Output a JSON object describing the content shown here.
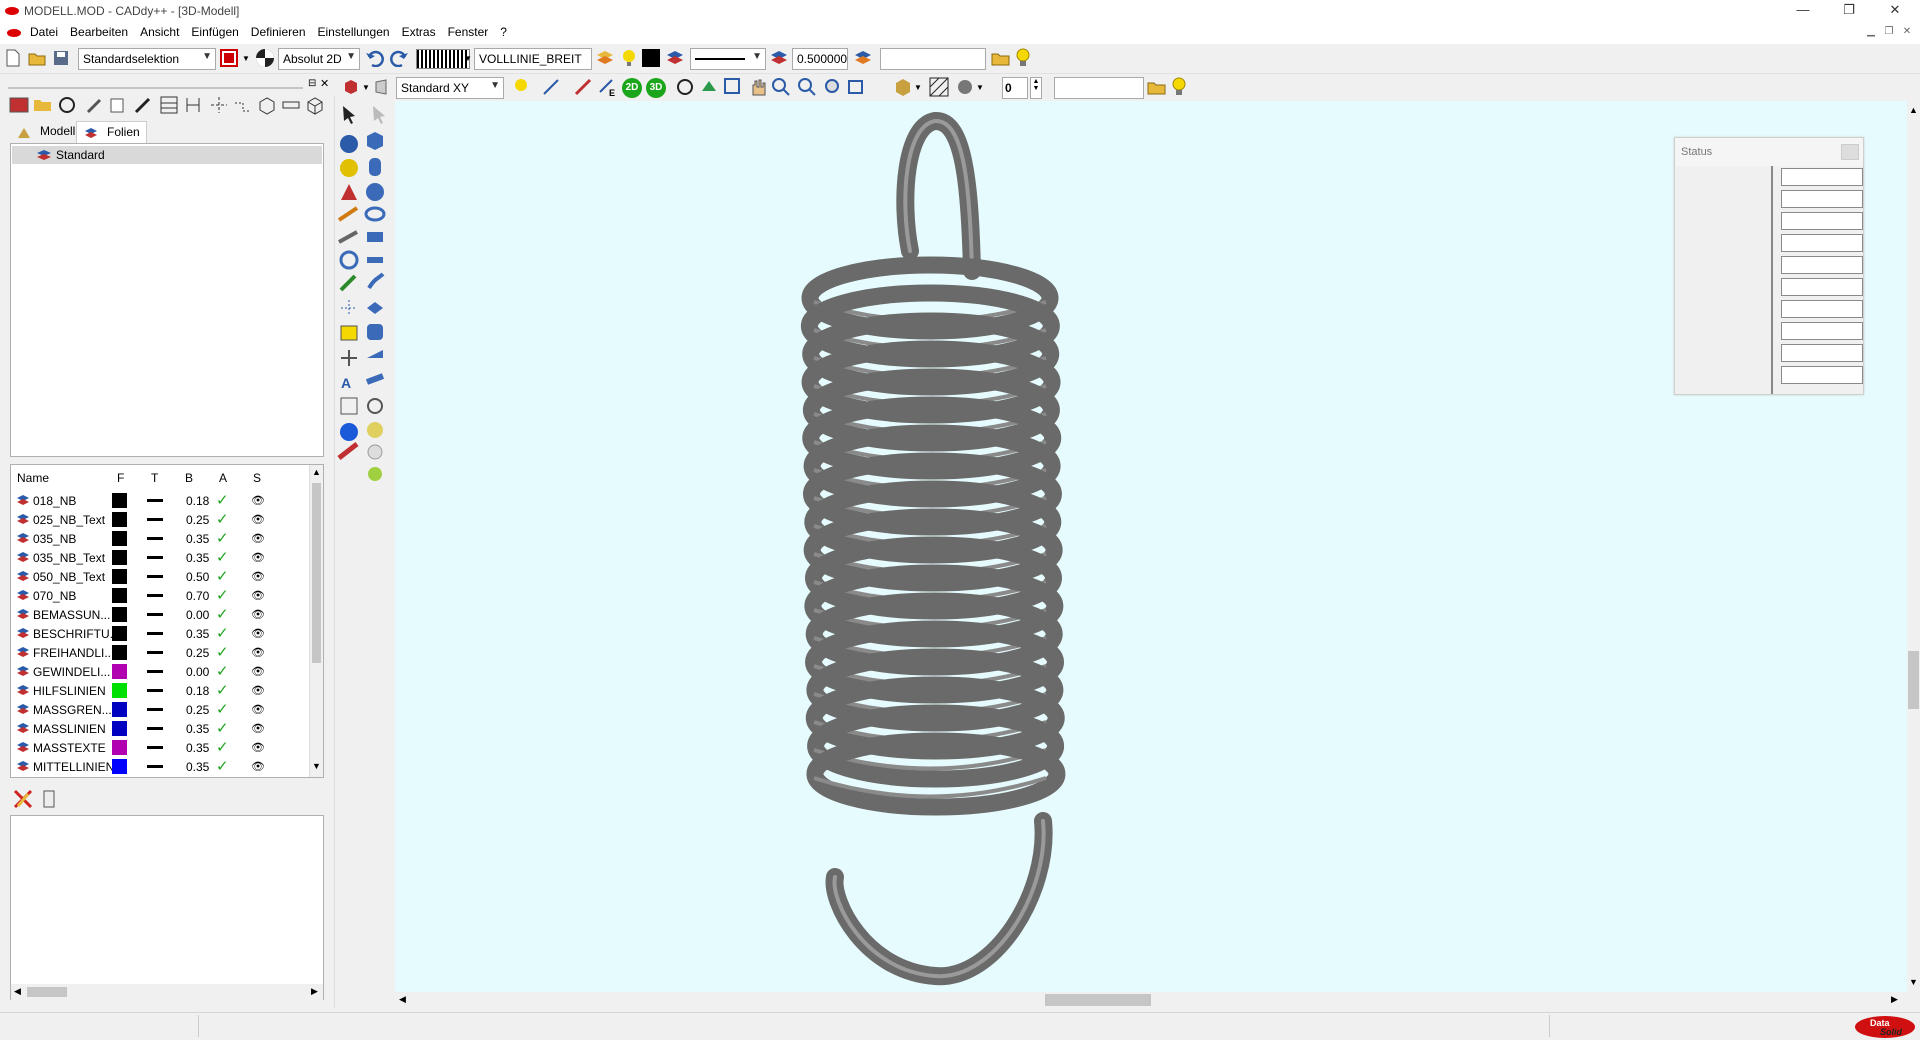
{
  "window": {
    "title": "MODELL.MOD  -  CADdy++ - [3D-Modell]",
    "min": "—",
    "max": "❐",
    "close": "✕"
  },
  "menu": [
    "Datei",
    "Bearbeiten",
    "Ansicht",
    "Einfügen",
    "Definieren",
    "Einstellungen",
    "Extras",
    "Fenster",
    "?"
  ],
  "toolbar1": {
    "selection_mode": "Standardselektion",
    "coord_mode": "Absolut 2D",
    "linetype_name": "VOLLLINIE_BREIT",
    "line_width": "0.500000",
    "text_field": ""
  },
  "toolbar2": {
    "view_plane": "Standard XY",
    "btn_2d": "2D",
    "btn_3d": "3D",
    "step_value": "0",
    "text_field": ""
  },
  "tabs": [
    {
      "label": "Modell",
      "active": false
    },
    {
      "label": "Folien",
      "active": true
    }
  ],
  "layer_tree": {
    "root": "Standard"
  },
  "layer_table": {
    "headers": {
      "name": "Name",
      "f": "F",
      "t": "T",
      "b": "B",
      "a": "A",
      "s": "S"
    },
    "rows": [
      {
        "name": "018_NB",
        "color": "#000000",
        "width": "0.18"
      },
      {
        "name": "025_NB_Text",
        "color": "#000000",
        "width": "0.25"
      },
      {
        "name": "035_NB",
        "color": "#000000",
        "width": "0.35"
      },
      {
        "name": "035_NB_Text",
        "color": "#000000",
        "width": "0.35"
      },
      {
        "name": "050_NB_Text",
        "color": "#000000",
        "width": "0.50"
      },
      {
        "name": "070_NB",
        "color": "#000000",
        "width": "0.70"
      },
      {
        "name": "BEMASSUN...",
        "color": "#000000",
        "width": "0.00"
      },
      {
        "name": "BESCHRIFTU...",
        "color": "#000000",
        "width": "0.35"
      },
      {
        "name": "FREIHANDLI...",
        "color": "#000000",
        "width": "0.25"
      },
      {
        "name": "GEWINDELI...",
        "color": "#b000b0",
        "width": "0.00"
      },
      {
        "name": "HILFSLINIEN",
        "color": "#00e000",
        "width": "0.18"
      },
      {
        "name": "MASSGREN...",
        "color": "#0000c0",
        "width": "0.25"
      },
      {
        "name": "MASSLINIEN",
        "color": "#0000c0",
        "width": "0.35"
      },
      {
        "name": "MASSTEXTE",
        "color": "#b000b0",
        "width": "0.35"
      },
      {
        "name": "MITTELLINIEN",
        "color": "#0000ff",
        "width": "0.35"
      }
    ]
  },
  "status_panel": {
    "title": "Status",
    "field_count": 10
  },
  "colors": {
    "viewport_bg": "#e6fbfd",
    "spring": "#6a6a6a"
  },
  "brand": "Data Solid"
}
